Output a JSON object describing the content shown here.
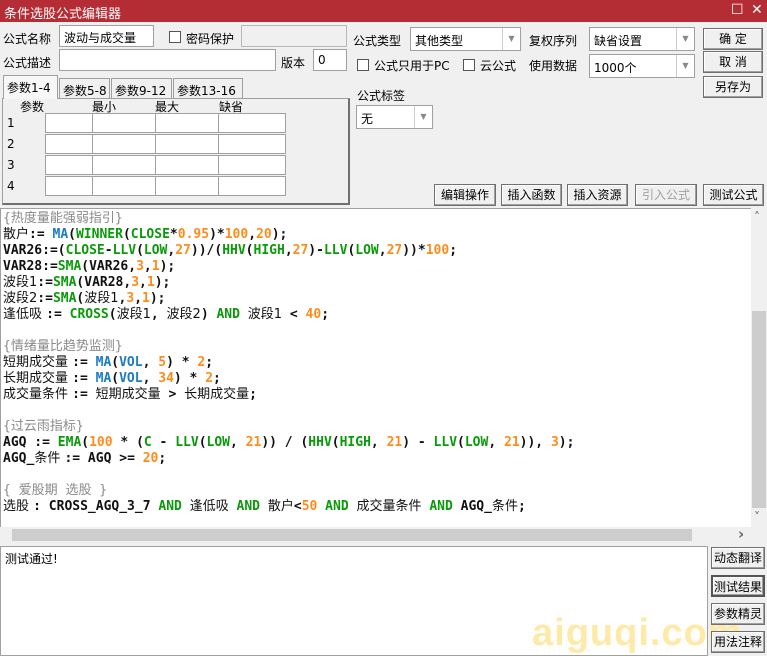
{
  "window": {
    "title": "条件选股公式编辑器",
    "maximize_icon": "☐",
    "close_icon": "✕"
  },
  "form": {
    "name_label": "公式名称",
    "name_value": "波动与成交量",
    "password_label": "密码保护",
    "password_checked": false,
    "desc_label": "公式描述",
    "desc_value": "",
    "version_label": "版本",
    "version_value": "0",
    "type_label": "公式类型",
    "type_value": "其他类型",
    "fuquan_label": "复权序列",
    "fuquan_value": "缺省设置",
    "pc_only_label": "公式只用于PC",
    "pc_only_checked": false,
    "cloud_label": "云公式",
    "cloud_checked": false,
    "data_label": "使用数据",
    "data_value": "1000个",
    "tag_label": "公式标签",
    "tag_value": "无"
  },
  "buttons": {
    "ok": "确  定",
    "cancel": "取  消",
    "save_as": "另存为",
    "edit_ops": "编辑操作",
    "insert_func": "插入函数",
    "insert_res": "插入资源",
    "import": "引入公式",
    "test": "测试公式"
  },
  "param_tabs": [
    "参数1-4",
    "参数5-8",
    "参数9-12",
    "参数13-16"
  ],
  "param_headers": [
    "参数",
    "最小",
    "最大",
    "缺省"
  ],
  "param_rows": [
    "1",
    "2",
    "3",
    "4"
  ],
  "code_lines": [
    [
      [
        "{热度量能强弱指引}",
        "cm"
      ]
    ],
    [
      [
        "散户",
        "tx cn"
      ],
      [
        ":= ",
        "tx"
      ],
      [
        "MA",
        "fn"
      ],
      [
        "(",
        "tx"
      ],
      [
        "WINNER",
        "kw"
      ],
      [
        "(",
        "tx"
      ],
      [
        "CLOSE",
        "kw"
      ],
      [
        "*",
        "tx"
      ],
      [
        "0.95",
        "num"
      ],
      [
        ")*",
        "tx"
      ],
      [
        "100",
        "num"
      ],
      [
        ",",
        "tx"
      ],
      [
        "20",
        "num"
      ],
      [
        ");",
        "tx"
      ]
    ],
    [
      [
        "VAR26:=(",
        "tx"
      ],
      [
        "CLOSE",
        "kw"
      ],
      [
        "-",
        "tx"
      ],
      [
        "LLV",
        "kw"
      ],
      [
        "(",
        "tx"
      ],
      [
        "LOW",
        "kw"
      ],
      [
        ",",
        "tx"
      ],
      [
        "27",
        "num"
      ],
      [
        "))/(",
        "tx"
      ],
      [
        "HHV",
        "kw"
      ],
      [
        "(",
        "tx"
      ],
      [
        "HIGH",
        "kw"
      ],
      [
        ",",
        "tx"
      ],
      [
        "27",
        "num"
      ],
      [
        ")-",
        "tx"
      ],
      [
        "LLV",
        "kw"
      ],
      [
        "(",
        "tx"
      ],
      [
        "LOW",
        "kw"
      ],
      [
        ",",
        "tx"
      ],
      [
        "27",
        "num"
      ],
      [
        "))*",
        "tx"
      ],
      [
        "100",
        "num"
      ],
      [
        ";",
        "tx"
      ]
    ],
    [
      [
        "VAR28:=",
        "tx"
      ],
      [
        "SMA",
        "kw"
      ],
      [
        "(VAR26,",
        "tx"
      ],
      [
        "3",
        "num"
      ],
      [
        ",",
        "tx"
      ],
      [
        "1",
        "num"
      ],
      [
        ");",
        "tx"
      ]
    ],
    [
      [
        "波段1",
        "tx cn"
      ],
      [
        ":=",
        "tx"
      ],
      [
        "SMA",
        "kw"
      ],
      [
        "(VAR28,",
        "tx"
      ],
      [
        "3",
        "num"
      ],
      [
        ",",
        "tx"
      ],
      [
        "1",
        "num"
      ],
      [
        ");",
        "tx"
      ]
    ],
    [
      [
        "波段2",
        "tx cn"
      ],
      [
        ":=",
        "tx"
      ],
      [
        "SMA",
        "kw"
      ],
      [
        "(",
        "tx"
      ],
      [
        "波段1",
        "tx cn"
      ],
      [
        ",",
        "tx"
      ],
      [
        "3",
        "num"
      ],
      [
        ",",
        "tx"
      ],
      [
        "1",
        "num"
      ],
      [
        ");",
        "tx"
      ]
    ],
    [
      [
        "逢低吸 ",
        "tx cn"
      ],
      [
        ":= ",
        "tx"
      ],
      [
        "CROSS",
        "kw"
      ],
      [
        "(",
        "tx"
      ],
      [
        "波段1",
        "tx cn"
      ],
      [
        ", ",
        "tx"
      ],
      [
        "波段2",
        "tx cn"
      ],
      [
        ") ",
        "tx"
      ],
      [
        "AND",
        "kw"
      ],
      [
        " ",
        "tx"
      ],
      [
        "波段1",
        "tx cn"
      ],
      [
        " < ",
        "tx"
      ],
      [
        "40",
        "num"
      ],
      [
        ";",
        "tx"
      ]
    ],
    [],
    [
      [
        "{情绪量比趋势监测}",
        "cm"
      ]
    ],
    [
      [
        "短期成交量 ",
        "tx cn"
      ],
      [
        ":= ",
        "tx"
      ],
      [
        "MA",
        "fn"
      ],
      [
        "(",
        "tx"
      ],
      [
        "VOL",
        "fn"
      ],
      [
        ", ",
        "tx"
      ],
      [
        "5",
        "num"
      ],
      [
        ") * ",
        "tx"
      ],
      [
        "2",
        "num"
      ],
      [
        ";",
        "tx"
      ]
    ],
    [
      [
        "长期成交量 ",
        "tx cn"
      ],
      [
        ":= ",
        "tx"
      ],
      [
        "MA",
        "fn"
      ],
      [
        "(",
        "tx"
      ],
      [
        "VOL",
        "fn"
      ],
      [
        ", ",
        "tx"
      ],
      [
        "34",
        "num"
      ],
      [
        ") * ",
        "tx"
      ],
      [
        "2",
        "num"
      ],
      [
        ";",
        "tx"
      ]
    ],
    [
      [
        "成交量条件 ",
        "tx cn"
      ],
      [
        ":= ",
        "tx"
      ],
      [
        "短期成交量",
        "tx cn"
      ],
      [
        " > ",
        "tx"
      ],
      [
        "长期成交量",
        "tx cn"
      ],
      [
        ";",
        "tx"
      ]
    ],
    [],
    [
      [
        "{过云雨指标}",
        "cm"
      ]
    ],
    [
      [
        "AGQ := ",
        "tx"
      ],
      [
        "EMA",
        "kw"
      ],
      [
        "(",
        "tx"
      ],
      [
        "100",
        "num"
      ],
      [
        " * (",
        "tx"
      ],
      [
        "C",
        "kw"
      ],
      [
        " - ",
        "tx"
      ],
      [
        "LLV",
        "kw"
      ],
      [
        "(",
        "tx"
      ],
      [
        "LOW",
        "kw"
      ],
      [
        ", ",
        "tx"
      ],
      [
        "21",
        "num"
      ],
      [
        ")) / (",
        "tx"
      ],
      [
        "HHV",
        "kw"
      ],
      [
        "(",
        "tx"
      ],
      [
        "HIGH",
        "kw"
      ],
      [
        ", ",
        "tx"
      ],
      [
        "21",
        "num"
      ],
      [
        ") - ",
        "tx"
      ],
      [
        "LLV",
        "kw"
      ],
      [
        "(",
        "tx"
      ],
      [
        "LOW",
        "kw"
      ],
      [
        ", ",
        "tx"
      ],
      [
        "21",
        "num"
      ],
      [
        ")), ",
        "tx"
      ],
      [
        "3",
        "num"
      ],
      [
        ");",
        "tx"
      ]
    ],
    [
      [
        "AGQ_",
        "tx"
      ],
      [
        "条件 ",
        "tx cn"
      ],
      [
        ":= AGQ >= ",
        "tx"
      ],
      [
        "20",
        "num"
      ],
      [
        ";",
        "tx"
      ]
    ],
    [],
    [
      [
        "{ 爱股期 选股 }",
        "cm"
      ]
    ],
    [
      [
        "选股 ",
        "tx cn"
      ],
      [
        ": CROSS_AGQ_3_7 ",
        "tx"
      ],
      [
        "AND",
        "kw"
      ],
      [
        " ",
        "tx"
      ],
      [
        "逢低吸",
        "tx cn"
      ],
      [
        " ",
        "tx"
      ],
      [
        "AND",
        "kw"
      ],
      [
        " ",
        "tx"
      ],
      [
        "散户",
        "tx cn"
      ],
      [
        "<",
        "tx"
      ],
      [
        "50",
        "num"
      ],
      [
        " ",
        "tx"
      ],
      [
        "AND",
        "kw"
      ],
      [
        " ",
        "tx"
      ],
      [
        "成交量条件",
        "tx cn"
      ],
      [
        " ",
        "tx"
      ],
      [
        "AND",
        "kw"
      ],
      [
        " AGQ_",
        "tx"
      ],
      [
        "条件",
        "tx cn"
      ],
      [
        ";",
        "tx"
      ]
    ]
  ],
  "output": {
    "text": "测试通过!"
  },
  "side_buttons": [
    "动态翻译",
    "测试结果",
    "参数精灵",
    "用法注释"
  ],
  "scroll": {
    "up_icon": "˄",
    "down_icon": "˅",
    "right_icon": "›"
  },
  "watermark": "aiguqi.com",
  "colors": {
    "titlebar": "#b52d34",
    "function": "#1a7cc4",
    "keyword": "#0a9a0a",
    "number": "#ff8c1a",
    "comment": "#8a8a8a"
  }
}
